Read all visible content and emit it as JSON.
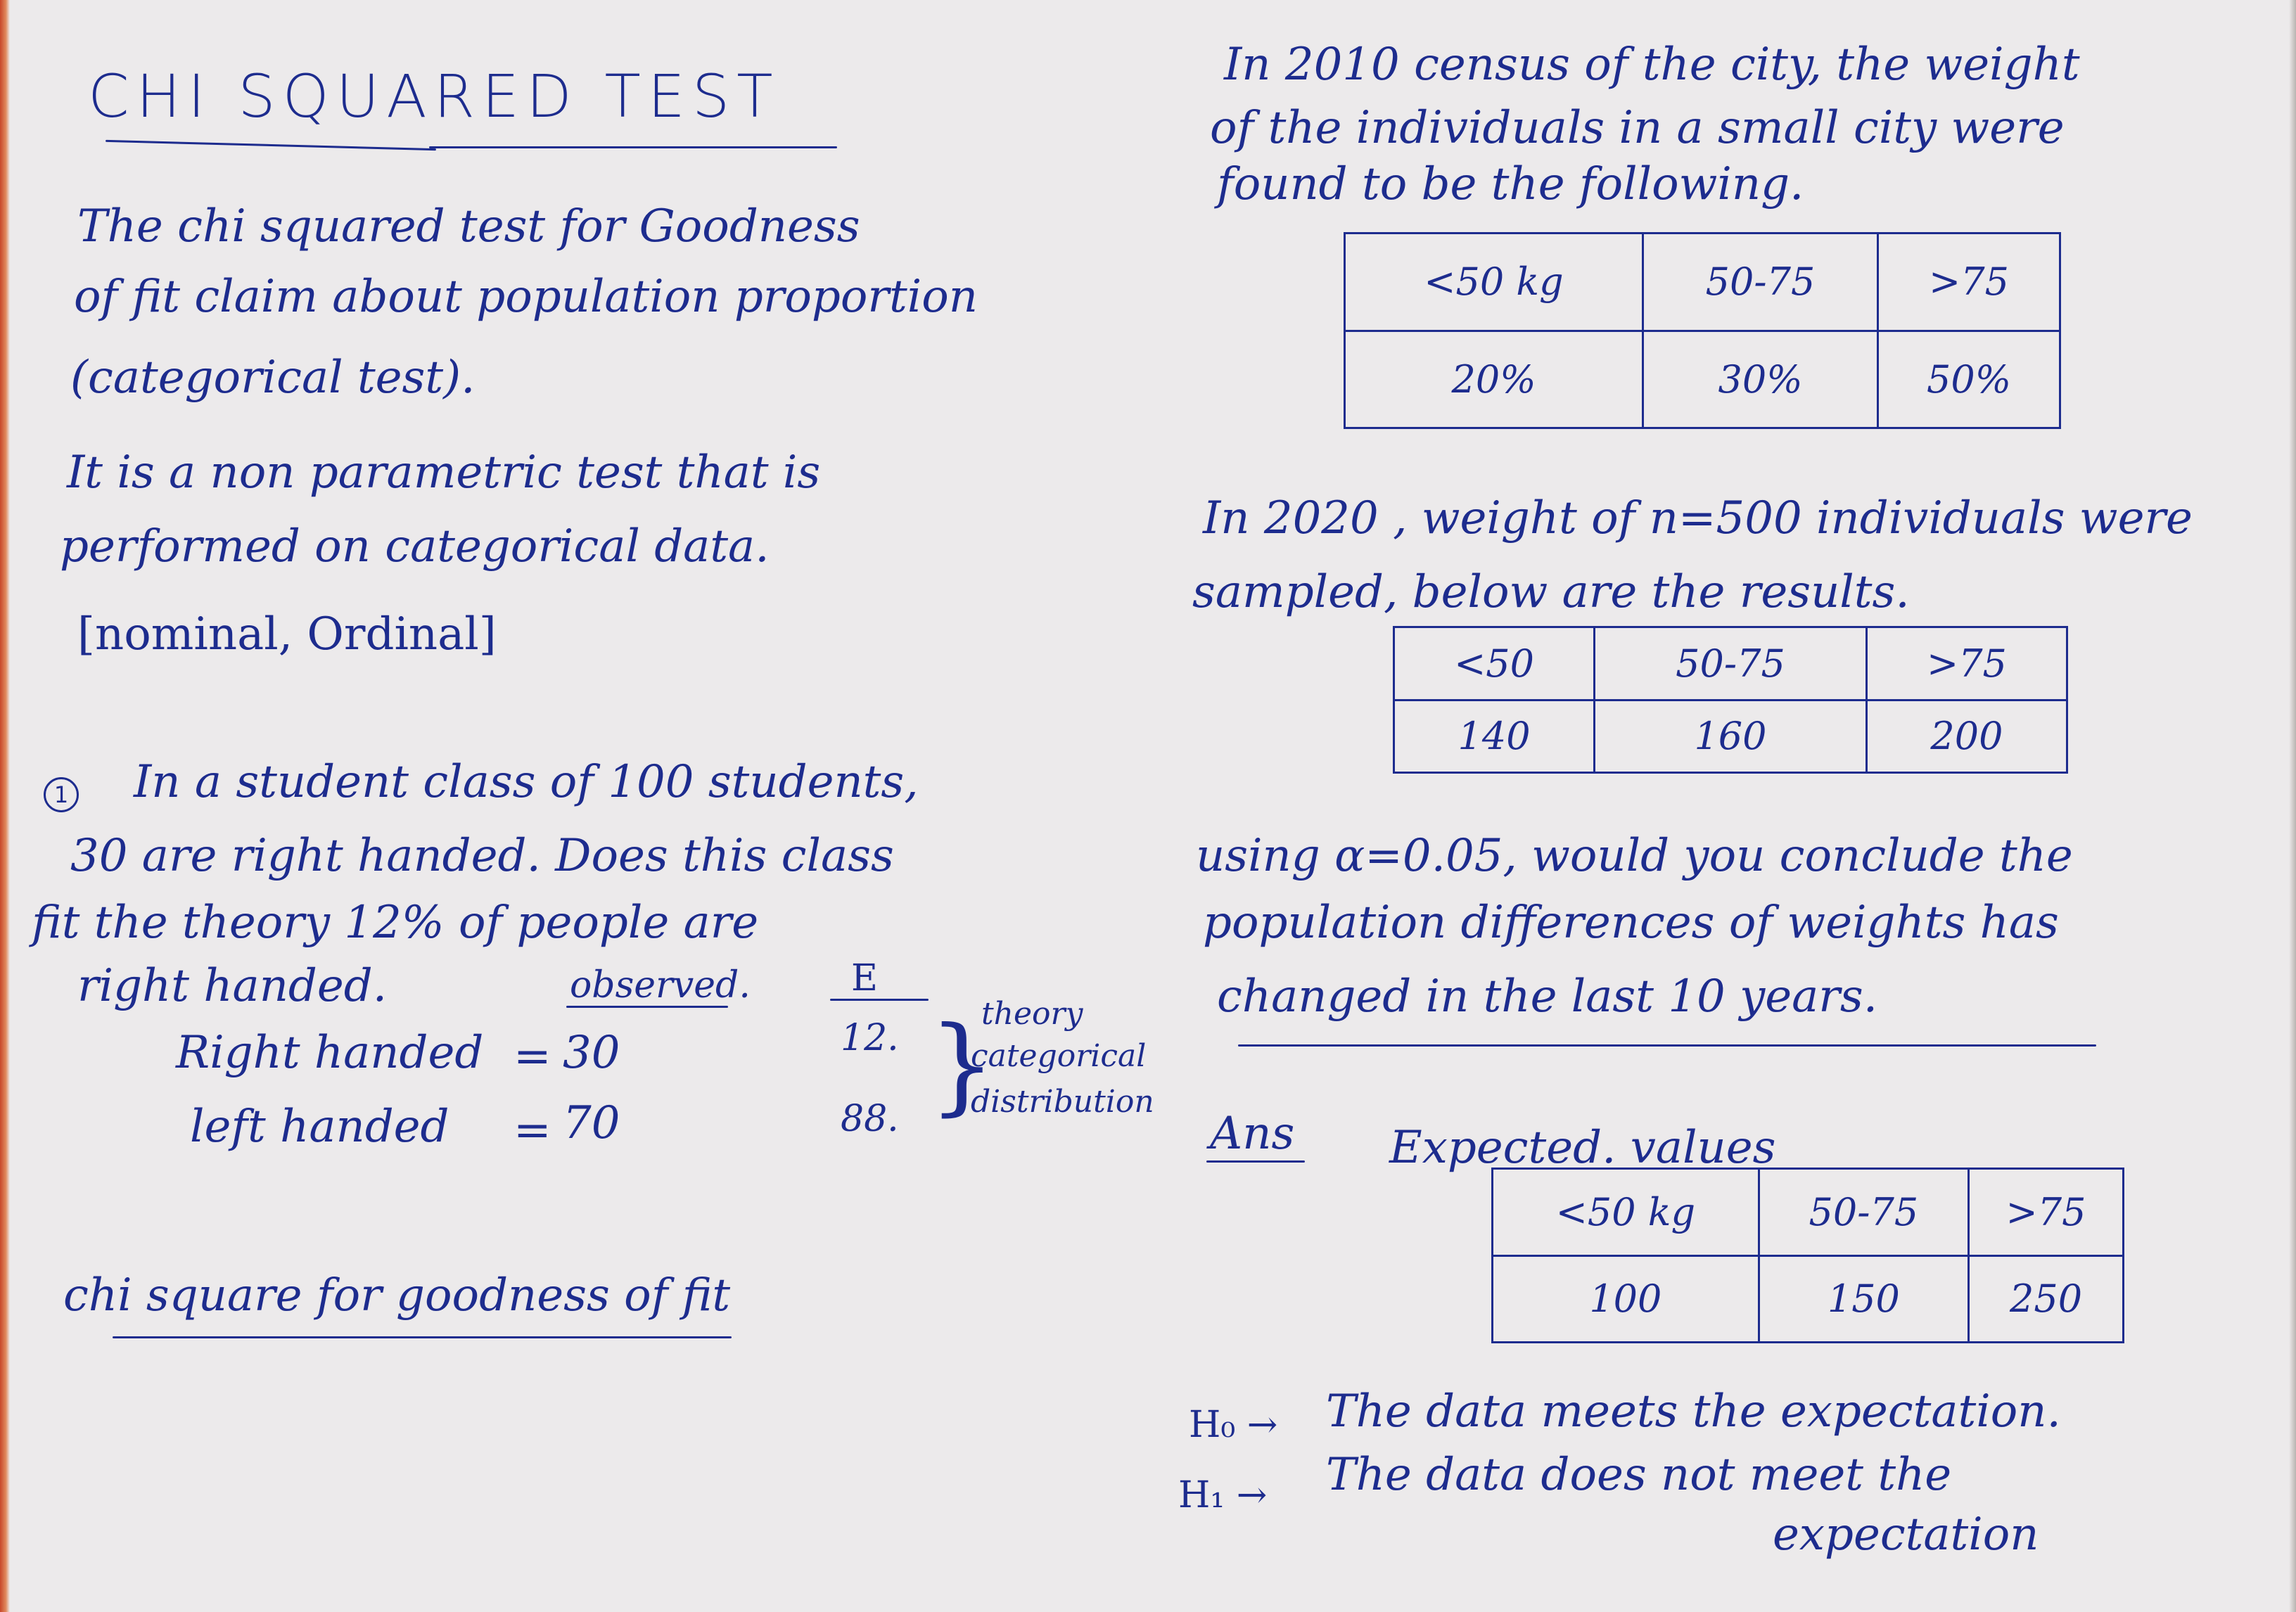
{
  "left": {
    "title": "CHI SQUARED TEST",
    "intro_lines": [
      "The chi squared test for Goodness",
      "of fit  claim about population proportion",
      "(categorical test)."
    ],
    "nonparam_lines": [
      "It is a non parametric test that is",
      "performed on categorical data.",
      "[nominal, Ordinal]"
    ],
    "q1_number": "1",
    "q1_lines": [
      "In a  student class of 100 students,",
      "30 are right handed. Does this class",
      "fit the theory 12% of people are",
      "right handed."
    ],
    "observed_header": "observed.",
    "expected_header": "E",
    "rows": [
      {
        "label": "Right handed",
        "eq": "=",
        "observed": "30",
        "expected": "12."
      },
      {
        "label": "left handed",
        "eq": "=",
        "observed": "70",
        "expected": "88."
      }
    ],
    "brace_note": [
      "theory",
      "categorical",
      "distribution"
    ],
    "footer": "chi square for goodness of fit"
  },
  "right": {
    "census_lines": [
      "In  2010  census of the city, the weight",
      "of the individuals in a small city were",
      "found to be the following."
    ],
    "table2010": {
      "headers": [
        "<50 kg",
        "50-75",
        ">75"
      ],
      "values": [
        "20%",
        "30%",
        "50%"
      ]
    },
    "sample_lines": [
      "In 2020 , weight of n=500  individuals were",
      "sampled, below are the results."
    ],
    "table2020": {
      "headers": [
        "<50",
        "50-75",
        ">75"
      ],
      "values": [
        "140",
        "160",
        "200"
      ]
    },
    "question_lines": [
      "using α=0.05,  would you conclude the",
      "population differences of weights has",
      "changed in the last  10 years."
    ],
    "ans_label": "Ans",
    "expected_label": "Expected. values",
    "table_expected": {
      "headers": [
        "<50 kg",
        "50-75",
        ">75"
      ],
      "values": [
        "100",
        "150",
        "250"
      ]
    },
    "h0_label": "H₀ →",
    "h0_text": "The data meets the expectation.",
    "h1_label": "H₁ →",
    "h1_text": "The data does not meet the",
    "h1_text2": "expectation"
  }
}
